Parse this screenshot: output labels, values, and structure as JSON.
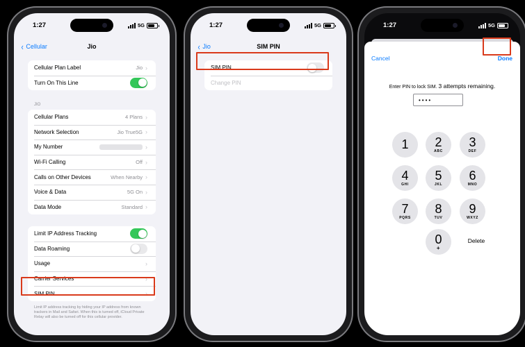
{
  "status": {
    "time": "1:27",
    "network": "5G"
  },
  "colors": {
    "accent": "#0a7cff",
    "toggle_on": "#34c759",
    "highlight": "#d93a1b"
  },
  "screen1": {
    "back_label": "Cellular",
    "title": "Jio",
    "group1": [
      {
        "label": "Cellular Plan Label",
        "value": "Jio"
      },
      {
        "label": "Turn On This Line",
        "toggle": "on"
      }
    ],
    "section_header": "JIO",
    "group2": [
      {
        "label": "Cellular Plans",
        "value": "4 Plans"
      },
      {
        "label": "Network Selection",
        "value": "Jio True5G"
      },
      {
        "label": "My Number",
        "value": ""
      },
      {
        "label": "Wi-Fi Calling",
        "value": "Off"
      },
      {
        "label": "Calls on Other Devices",
        "value": "When Nearby"
      },
      {
        "label": "Voice & Data",
        "value": "5G On"
      },
      {
        "label": "Data Mode",
        "value": "Standard"
      }
    ],
    "group3": [
      {
        "label": "Limit IP Address Tracking",
        "toggle": "on"
      },
      {
        "label": "Data Roaming",
        "toggle": "off"
      },
      {
        "label": "Usage"
      },
      {
        "label": "Carrier Services"
      },
      {
        "label": "SIM PIN"
      }
    ],
    "footnote": "Limit IP address tracking by hiding your IP address from known trackers in Mail and Safari. When this is turned off, iCloud Private Relay will also be turned off for this cellular provider."
  },
  "screen2": {
    "back_label": "Jio",
    "title": "SIM PIN",
    "sim_pin_label": "SIM PIN",
    "sim_pin_toggle": "off",
    "change_pin_label": "Change PIN"
  },
  "screen3": {
    "cancel_label": "Cancel",
    "done_label": "Done",
    "prompt_text": "Enter PIN to lock SIM.",
    "attempts_text": "3 attempts remaining.",
    "pin_value": "••••",
    "keys": [
      {
        "digit": "1",
        "letters": ""
      },
      {
        "digit": "2",
        "letters": "ABC"
      },
      {
        "digit": "3",
        "letters": "DEF"
      },
      {
        "digit": "4",
        "letters": "GHI"
      },
      {
        "digit": "5",
        "letters": "JKL"
      },
      {
        "digit": "6",
        "letters": "MNO"
      },
      {
        "digit": "7",
        "letters": "PQRS"
      },
      {
        "digit": "8",
        "letters": "TUV"
      },
      {
        "digit": "9",
        "letters": "WXYZ"
      },
      {
        "digit": "0",
        "letters": "+"
      }
    ],
    "delete_label": "Delete"
  }
}
